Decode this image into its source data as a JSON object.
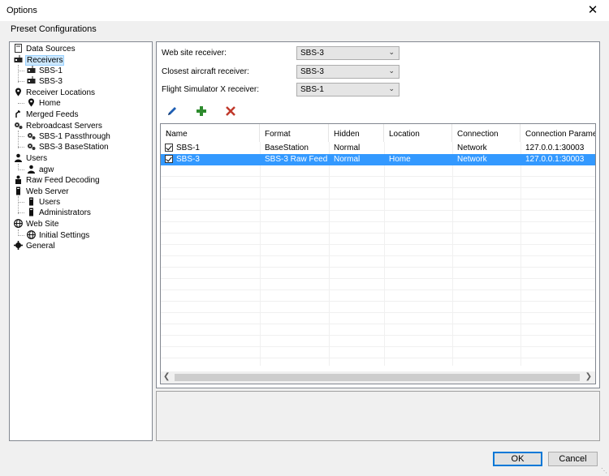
{
  "window": {
    "title": "Options",
    "close_glyph": "✕"
  },
  "menubar": {
    "preset": "Preset Configurations"
  },
  "tree": [
    {
      "label": "Data Sources",
      "icon": "data-sources-icon"
    },
    {
      "label": "Receivers",
      "icon": "receiver-icon",
      "selected": true
    },
    {
      "label": "SBS-1",
      "icon": "receiver-icon"
    },
    {
      "label": "SBS-3",
      "icon": "receiver-icon"
    },
    {
      "label": "Receiver Locations",
      "icon": "location-pin-icon"
    },
    {
      "label": "Home",
      "icon": "location-pin-icon"
    },
    {
      "label": "Merged Feeds",
      "icon": "merge-icon"
    },
    {
      "label": "Rebroadcast Servers",
      "icon": "rebroadcast-icon"
    },
    {
      "label": "SBS-1 Passthrough",
      "icon": "rebroadcast-icon"
    },
    {
      "label": "SBS-3 BaseStation",
      "icon": "rebroadcast-icon"
    },
    {
      "label": "Users",
      "icon": "user-icon"
    },
    {
      "label": "agw",
      "icon": "user-icon"
    },
    {
      "label": "Raw Feed Decoding",
      "icon": "decoding-icon"
    },
    {
      "label": "Web Server",
      "icon": "server-icon"
    },
    {
      "label": "Users",
      "icon": "server-icon"
    },
    {
      "label": "Administrators",
      "icon": "server-icon"
    },
    {
      "label": "Web Site",
      "icon": "globe-icon"
    },
    {
      "label": "Initial Settings",
      "icon": "globe-icon"
    },
    {
      "label": "General",
      "icon": "gear-icon"
    }
  ],
  "fields": {
    "web_site_receiver": {
      "label": "Web site receiver:",
      "value": "SBS-3"
    },
    "closest_aircraft_receiver": {
      "label": "Closest aircraft receiver:",
      "value": "SBS-3"
    },
    "fsx_receiver": {
      "label": "Flight Simulator X receiver:",
      "value": "SBS-1"
    }
  },
  "toolbar": {
    "edit_icon": "pencil-icon",
    "add_icon": "plus-icon",
    "delete_icon": "delete-x-icon"
  },
  "grid": {
    "columns": [
      "Name",
      "Format",
      "Hidden",
      "Location",
      "Connection",
      "Connection Paramete"
    ],
    "rows": [
      {
        "checked": true,
        "name": "SBS-1",
        "format": "BaseStation",
        "hidden": "Normal",
        "location": "",
        "connection": "Network",
        "params": "127.0.0.1:30003",
        "selected": false
      },
      {
        "checked": true,
        "name": "SBS-3",
        "format": "SBS-3 Raw Feed",
        "hidden": "Normal",
        "location": "Home",
        "connection": "Network",
        "params": "127.0.0.1:30003",
        "selected": true
      }
    ]
  },
  "buttons": {
    "ok": "OK",
    "cancel": "Cancel"
  },
  "colors": {
    "selection": "#3399ff",
    "tree_selection": "#cce8ff",
    "add": "#2e8b2e",
    "delete": "#c0392b",
    "edit": "#1f5fb3"
  }
}
